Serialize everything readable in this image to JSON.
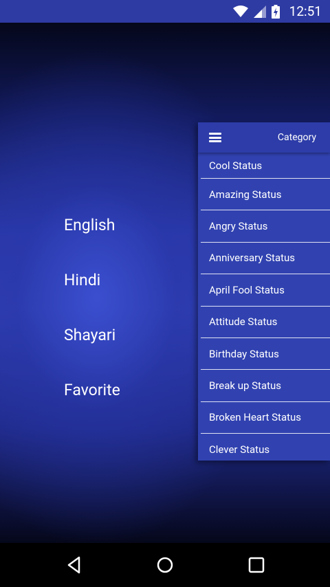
{
  "status_bar": {
    "time": "12:51",
    "icons": [
      "wifi-icon",
      "cell-signal-icon",
      "battery-charging-icon"
    ]
  },
  "main_menu": {
    "items": [
      "English",
      "Hindi",
      "Shayari",
      "Favorite"
    ]
  },
  "drawer": {
    "title": "Category",
    "categories": [
      "Cool Status",
      "Amazing Status",
      "Angry Status",
      "Anniversary Status",
      "April Fool Status",
      "Attitude Status",
      "Birthday Status",
      "Break up Status",
      "Broken Heart Status",
      "Clever Status"
    ]
  },
  "nav_bar": {
    "buttons": [
      "back-icon",
      "home-icon",
      "recents-icon"
    ]
  },
  "colors": {
    "status_bar": "#2e3ba3",
    "drawer": "#3142b0",
    "drawer_header": "#2d3ca8"
  }
}
